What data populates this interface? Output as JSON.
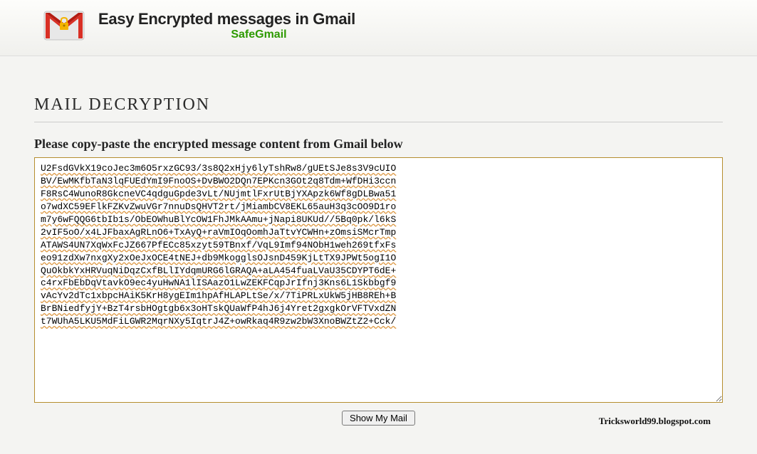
{
  "header": {
    "title": "Easy Encrypted messages in Gmail",
    "subtitle": "SafeGmail"
  },
  "main": {
    "section_title": "MAIL DECRYPTION",
    "instruction": "Please copy-paste the encrypted message content from Gmail below",
    "cipher_text": "U2FsdGVkX19coJec3m6O5rxzGC93/3s8Q2xHjy6lyTshRw8/gUEtSJe8s3V9cUIO\nBV/EwMKfbTaN3lqFUEdYmI9FnoOS+DvBWO2DQn7EPKcn3GOt2q8Tdm+WfDHi3ccn\nF8RsC4WunoR8GkcneVC4qdguGpde3vLt/NUjmtlFxrUtBjYXApzk6Wf8gDLBwa51\no7wdXC59EFlkFZKvZwuVGr7nnuDsQHVT2rt/jMiambCV8EKL65auH3q3cOO9D1ro\nm7y6wFQQG6tbIb1s/ObEOWhuBlYcOW1FhJMkAAmu+jNapi8UKUd//5Bq0pk/l6kS\n2vIF5oO/x4LJFbaxAgRLnO6+TxAyQ+raVmIOqOomhJaTtvYCWHn+zOmsiSMcrTmp\nATAWS4UN7XqWxFcJZ667PfECc85xzyt59TBnxf/VqL9Imf94NObH1weh269tfxFs\neo91zdXw7nxgXy2xOeJxOCE4tNEJ+db9MkogglsOJsnD459KjLtTX9JPWt5ogI1O\nQuOkbkYxHRVuqNiDqzCxfBLlIYdqmURG6lGRAQA+aLA454fuaLVaU35CDYPT6dE+\nc4rxFbEbDqVtavkO9ec4yuHwNA1lISAazO1LwZEKFCqpJrIfnj3Kns6L1Skbbgf9\nvAcYv2dTc1xbpcHAiK5KrH8ygEIm1hpAfHLAPLtSe/x/7TiPRLxUkW5jHB8REh+B\nBrBNiedfyjY+BzT4rsbHOgtgb6x3oHTskQUaWfP4hJ6j4Yret2gxgkOrVFTVxdZN\nt7WUhA5LKU5MdFiLGWR2MqrNXy5IqtrJ4Z+owRkaq4R9zw2bW3XnoBWZtZ2+Cck/",
    "button_label": "Show My Mail"
  },
  "watermark": "Tricksworld99.blogspot.com"
}
